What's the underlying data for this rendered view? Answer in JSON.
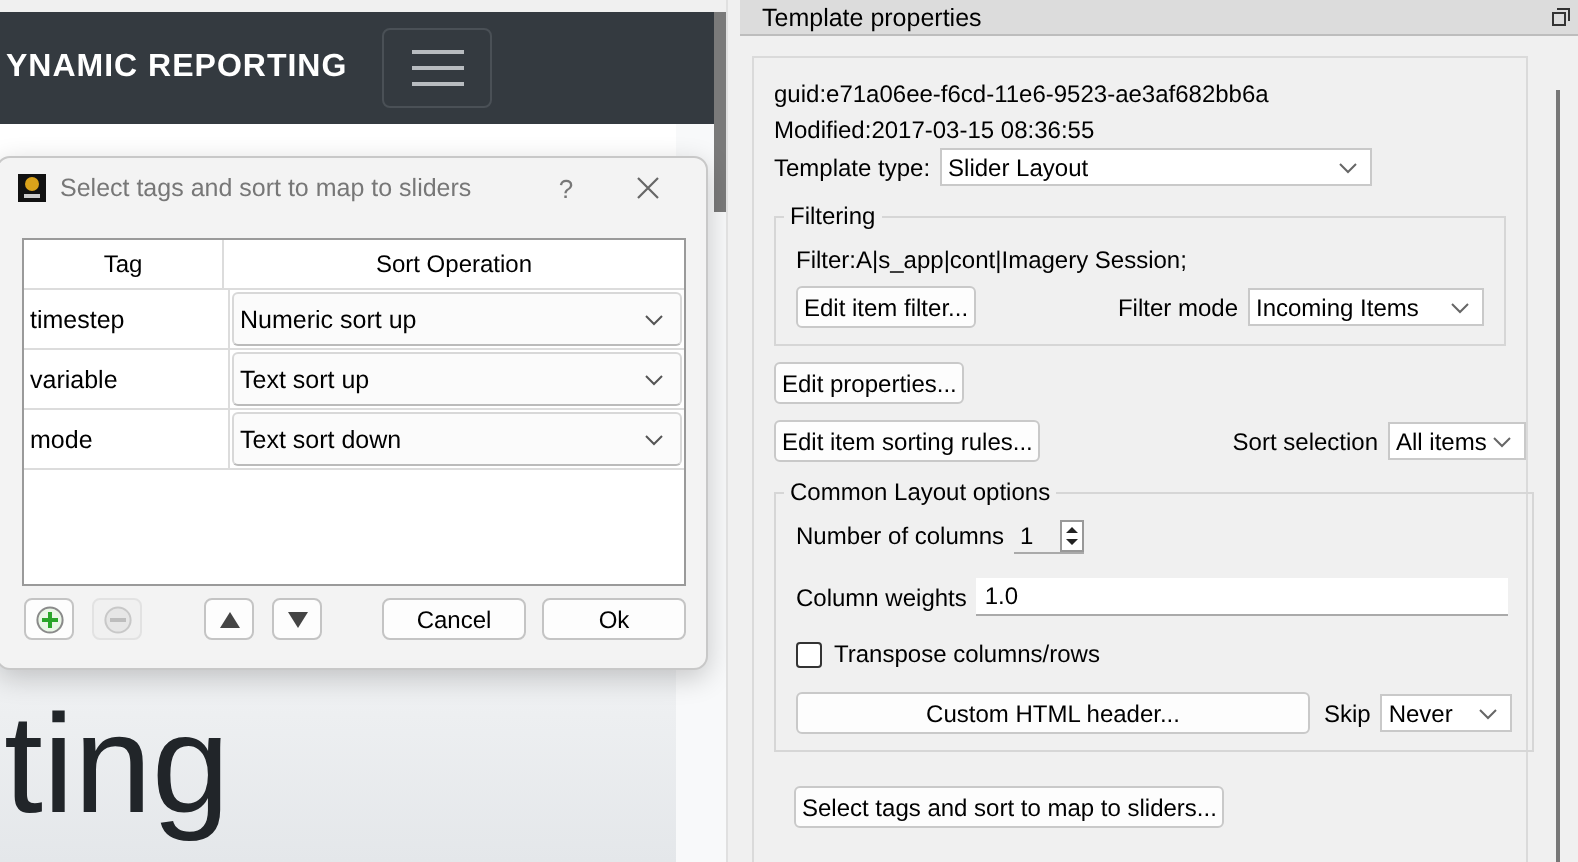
{
  "browser_page": {
    "brand": "YNAMIC REPORTING",
    "heading_fragment": "ting"
  },
  "dialog": {
    "title": "Select tags and sort to map to sliders",
    "help": "?",
    "columns": [
      "Tag",
      "Sort Operation"
    ],
    "rows": [
      {
        "tag": "timestep",
        "sort": "Numeric sort up"
      },
      {
        "tag": "variable",
        "sort": "Text sort up"
      },
      {
        "tag": "mode",
        "sort": "Text sort down"
      }
    ],
    "tool_buttons": [
      {
        "kind": "add",
        "disabled": false
      },
      {
        "kind": "remove",
        "disabled": true
      },
      {
        "kind": "up",
        "disabled": false
      },
      {
        "kind": "down",
        "disabled": false
      }
    ],
    "cancel": "Cancel",
    "ok": "Ok"
  },
  "panel": {
    "title": "Template properties",
    "guid": "guid:e71a06ee-f6cd-11e6-9523-ae3af682bb6a",
    "modified": "Modified:2017-03-15 08:36:55",
    "template_type": {
      "label": "Template type:",
      "value": "Slider Layout"
    },
    "filtering": {
      "title": "Filtering",
      "filter": "Filter:A|s_app|cont|Imagery Session;",
      "edit_button": "Edit item filter...",
      "mode_label": "Filter mode",
      "mode_value": "Incoming Items"
    },
    "edit_properties": "Edit properties...",
    "edit_sorting": "Edit item sorting rules...",
    "sort_selection": {
      "label": "Sort selection",
      "value": "All items"
    },
    "layout": {
      "title": "Common Layout options",
      "columns_label": "Number of columns",
      "columns_value": "1",
      "weights_label": "Column weights",
      "weights_value": "1.0",
      "transpose": {
        "label": "Transpose columns/rows",
        "checked": false
      },
      "html_button": "Custom HTML header...",
      "skip_label": "Skip",
      "skip_value": "Never"
    },
    "select_tags_button": "Select tags and sort to map to sliders..."
  }
}
